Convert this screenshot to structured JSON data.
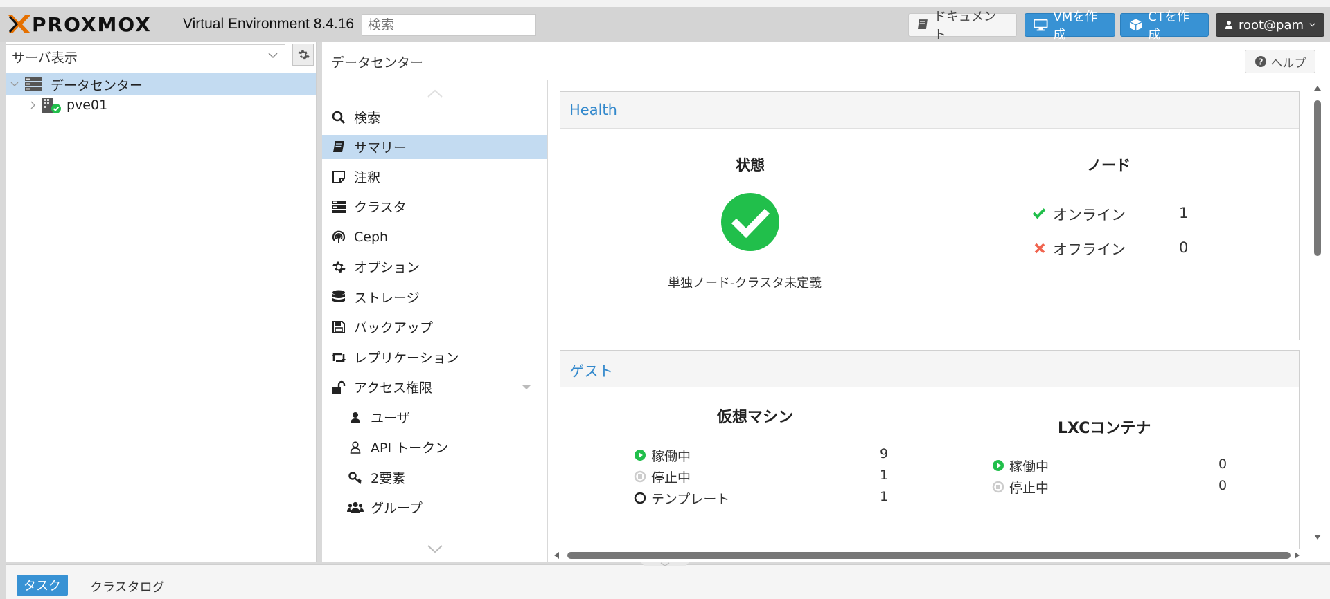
{
  "header": {
    "logo_text": "PROXMOX",
    "version": "Virtual Environment 8.4.16",
    "search_placeholder": "検索",
    "docs_label": "ドキュメント",
    "create_vm_label": "VMを作成",
    "create_ct_label": "CTを作成",
    "user_label": "root@pam"
  },
  "sidebar": {
    "view_select": "サーバ表示",
    "tree": {
      "datacenter": "データセンター",
      "node": "pve01"
    }
  },
  "main": {
    "title": "データセンター",
    "help_label": "ヘルプ",
    "nav": [
      {
        "label": "検索",
        "icon": "search-icon"
      },
      {
        "label": "サマリー",
        "icon": "book-icon"
      },
      {
        "label": "注釈",
        "icon": "note-icon"
      },
      {
        "label": "クラスタ",
        "icon": "server-icon"
      },
      {
        "label": "Ceph",
        "icon": "ceph-icon"
      },
      {
        "label": "オプション",
        "icon": "gear-icon"
      },
      {
        "label": "ストレージ",
        "icon": "database-icon"
      },
      {
        "label": "バックアップ",
        "icon": "floppy-icon"
      },
      {
        "label": "レプリケーション",
        "icon": "retweet-icon"
      },
      {
        "label": "アクセス権限",
        "icon": "unlock-icon"
      },
      {
        "label": "ユーザ",
        "icon": "user-icon"
      },
      {
        "label": "API トークン",
        "icon": "user-outline-icon"
      },
      {
        "label": "2要素",
        "icon": "key-icon"
      },
      {
        "label": "グループ",
        "icon": "users-icon"
      }
    ],
    "health": {
      "title": "Health",
      "status_heading": "状態",
      "status_text": "単独ノード-クラスタ未定義",
      "nodes_heading": "ノード",
      "online_label": "オンライン",
      "online_count": "1",
      "offline_label": "オフライン",
      "offline_count": "0"
    },
    "guests": {
      "title": "ゲスト",
      "vm_heading": "仮想マシン",
      "vm_running_label": "稼働中",
      "vm_running": "9",
      "vm_stopped_label": "停止中",
      "vm_stopped": "1",
      "vm_template_label": "テンプレート",
      "vm_template": "1",
      "lxc_heading": "LXCコンテナ",
      "lxc_running_label": "稼働中",
      "lxc_running": "0",
      "lxc_stopped_label": "停止中",
      "lxc_stopped": "0"
    }
  },
  "bottom": {
    "tasks_tab": "タスク",
    "cluster_log_tab": "クラスタログ"
  },
  "colors": {
    "accent": "#3892d4",
    "selection": "#c3dbf1",
    "ok_green": "#21bf4b",
    "error_red": "#f0634e",
    "logo_orange": "#e57000"
  }
}
